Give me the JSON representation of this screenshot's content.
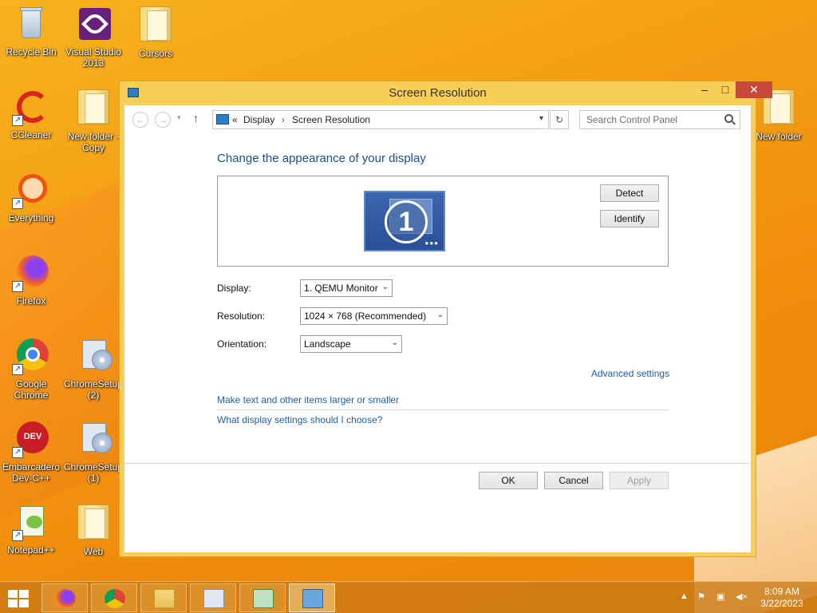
{
  "desktop": {
    "icons": [
      {
        "label": "Recycle Bin"
      },
      {
        "label": "Visual Studio 2013"
      },
      {
        "label": "Cursors"
      },
      {
        "label": "CCleaner"
      },
      {
        "label": "New folder - Copy"
      },
      {
        "label": "Everything"
      },
      {
        "label": "Firefox"
      },
      {
        "label": "Google Chrome"
      },
      {
        "label": "ChromeSetup (2)"
      },
      {
        "label": "Embarcadero Dev-C++"
      },
      {
        "label": "ChromeSetup (1)"
      },
      {
        "label": "Notepad++"
      },
      {
        "label": "Web"
      },
      {
        "label": "New folder"
      }
    ]
  },
  "window": {
    "title": "Screen Resolution",
    "breadcrumb": {
      "prefix": "«",
      "part1": "Display",
      "sep": "›",
      "part2": "Screen Resolution"
    },
    "search_placeholder": "Search Control Panel",
    "heading": "Change the appearance of your display",
    "monitor_number": "1",
    "detect_label": "Detect",
    "identify_label": "Identify",
    "display_label": "Display:",
    "display_value": "1. QEMU Monitor",
    "resolution_label": "Resolution:",
    "resolution_value": "1024 × 768 (Recommended)",
    "orientation_label": "Orientation:",
    "orientation_value": "Landscape",
    "advanced_link": "Advanced settings",
    "link_larger": "Make text and other items larger or smaller",
    "link_choose": "What display settings should I choose?",
    "ok_label": "OK",
    "cancel_label": "Cancel",
    "apply_label": "Apply"
  },
  "taskbar": {
    "time": "8:09 AM",
    "date": "3/22/2023"
  },
  "colors": {
    "accent": "#1e4d8b",
    "link": "#1e5fa8",
    "close": "#c7493a",
    "frame": "#f8ce57"
  }
}
